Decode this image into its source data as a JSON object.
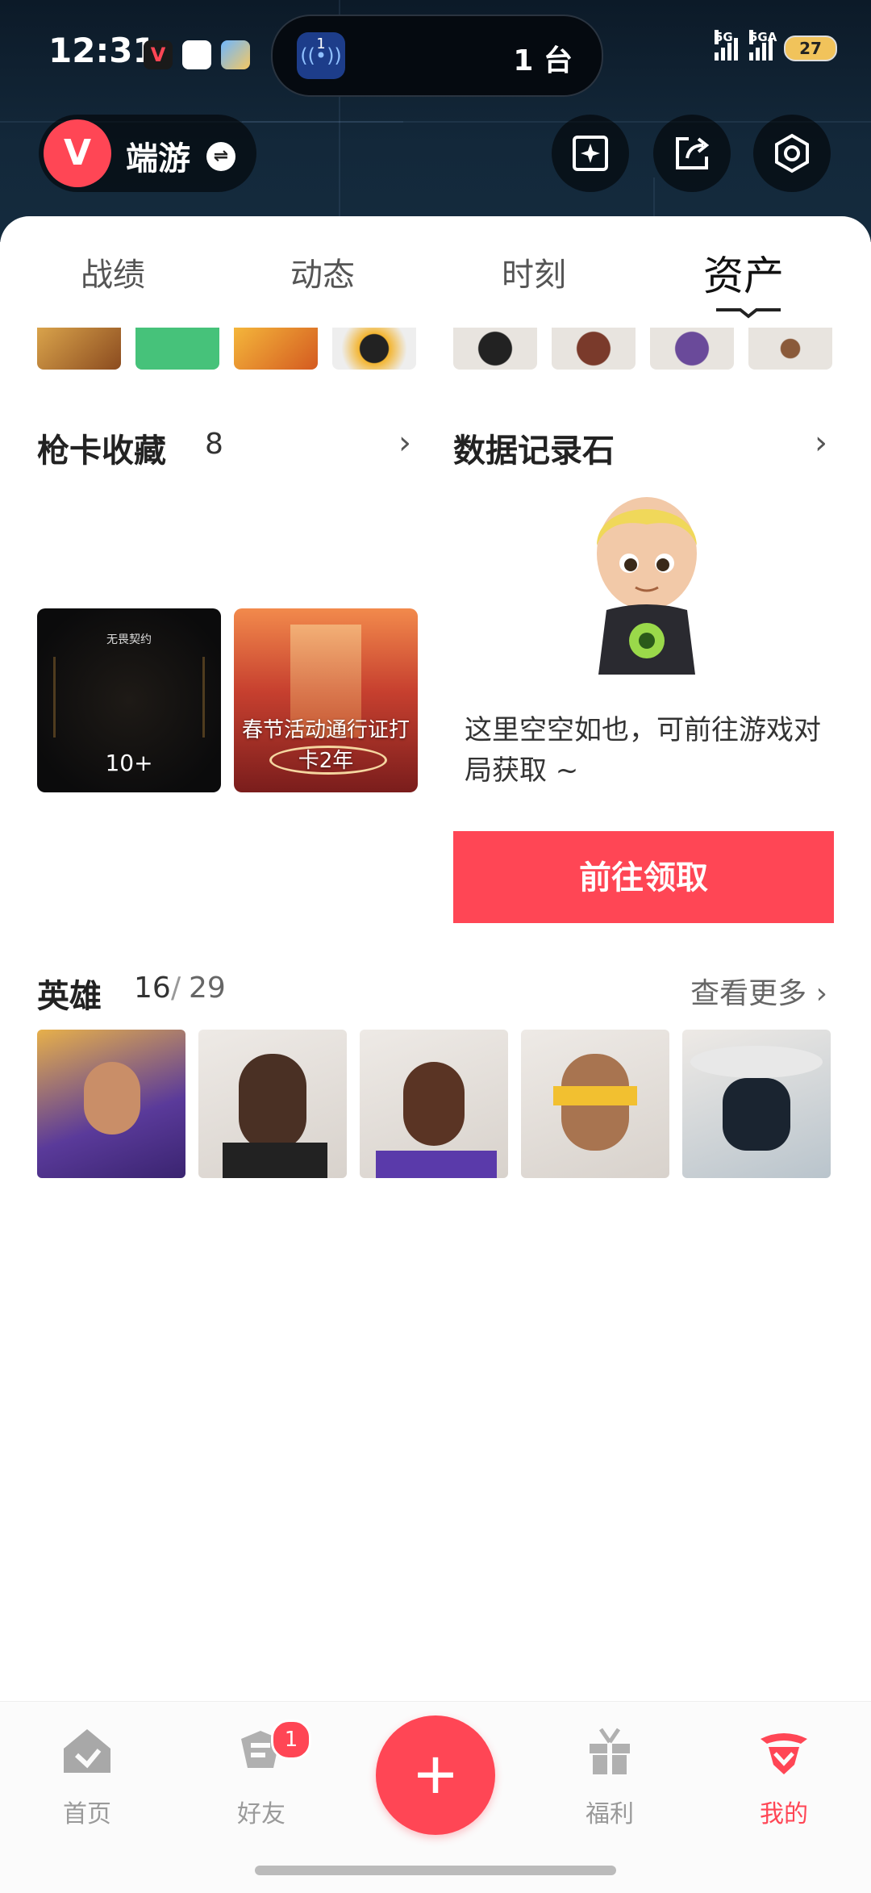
{
  "status_bar": {
    "time": "12:31",
    "island_count": "1",
    "island_text": "1 台",
    "signal1_label": "5G",
    "signal2_label": "5GA",
    "battery": "27"
  },
  "header": {
    "game_logo": "V",
    "game_name": "端游",
    "swap_icon": "swap-icon",
    "buttons": [
      "sparkle-card-icon",
      "share-icon",
      "settings-hexagon-icon"
    ]
  },
  "tabs": [
    {
      "label": "战绩",
      "active": false
    },
    {
      "label": "动态",
      "active": false
    },
    {
      "label": "时刻",
      "active": false
    },
    {
      "label": "资产",
      "active": true
    }
  ],
  "gun_cards": {
    "title": "枪卡收藏",
    "count": "8",
    "items": [
      {
        "small_text": "无畏契约",
        "label": "10+"
      },
      {
        "label": "春节活动通行证打卡2年"
      }
    ]
  },
  "data_stone": {
    "title": "数据记录石",
    "empty_text": "这里空空如也，可前往游戏对局获取 ~",
    "button": "前往领取"
  },
  "heroes": {
    "title": "英雄",
    "owned": "16",
    "separator": "/",
    "total": "29",
    "more": "查看更多"
  },
  "bottom_nav": {
    "items": [
      {
        "label": "首页",
        "icon": "home-icon"
      },
      {
        "label": "好友",
        "icon": "friends-icon",
        "badge": "1"
      },
      {
        "label": "福利",
        "icon": "gift-icon"
      },
      {
        "label": "我的",
        "icon": "profile-icon",
        "active": true
      }
    ],
    "fab": "+"
  },
  "colors": {
    "accent": "#ff4655",
    "header_bg": "#0c1a28"
  }
}
